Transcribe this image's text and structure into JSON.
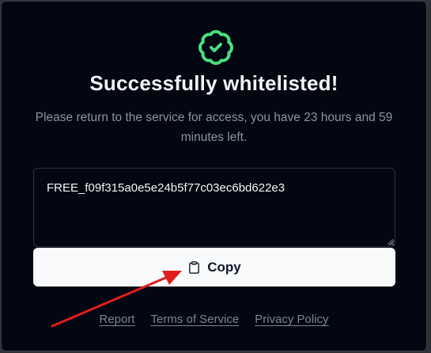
{
  "dialog": {
    "title": "Successfully whitelisted!",
    "subtitle": "Please return to the service for access, you have 23 hours and 59 minutes left.",
    "key_value": "FREE_f09f315a0e5e24b5f77c03ec6bd622e3",
    "copy_label": "Copy"
  },
  "footer": {
    "links": [
      "Report",
      "Terms of Service",
      "Privacy Policy"
    ]
  },
  "icons": {
    "badge": "verified-badge-icon",
    "copy": "clipboard-icon",
    "annotation": "red-arrow-annotation"
  },
  "colors": {
    "background": "#030712",
    "accent_green": "#4ade80",
    "button_bg": "#f8fafc",
    "annotation_red": "#e11d1d"
  }
}
